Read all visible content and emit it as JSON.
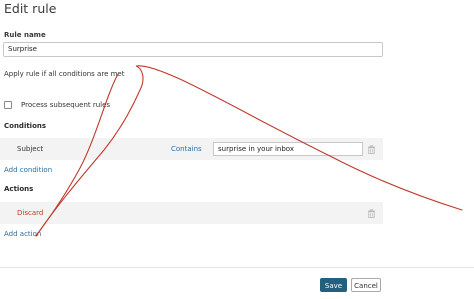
{
  "dialog": {
    "title": "Edit rule"
  },
  "rule_name": {
    "label": "Rule name",
    "value": "Surprise"
  },
  "apply_rule_text": "Apply rule if all conditions are met",
  "process_subsequent": {
    "label": "Process subsequent rules",
    "checked": false
  },
  "conditions": {
    "heading": "Conditions",
    "items": [
      {
        "field": "Subject",
        "operator": "Contains",
        "value": "surprise in your inbox",
        "delete_icon": "trash-icon"
      }
    ],
    "add_label": "Add condition"
  },
  "actions": {
    "heading": "Actions",
    "items": [
      {
        "name": "Discard",
        "delete_icon": "trash-icon"
      }
    ],
    "add_label": "Add action"
  },
  "footer": {
    "save_label": "Save",
    "cancel_label": "Cancel"
  },
  "colors": {
    "link": "#2e6da4",
    "primary_button": "#245f7d",
    "discard_text": "#c0392b",
    "annotation_stroke": "#c0392b",
    "row_background": "#f3f3f3"
  }
}
